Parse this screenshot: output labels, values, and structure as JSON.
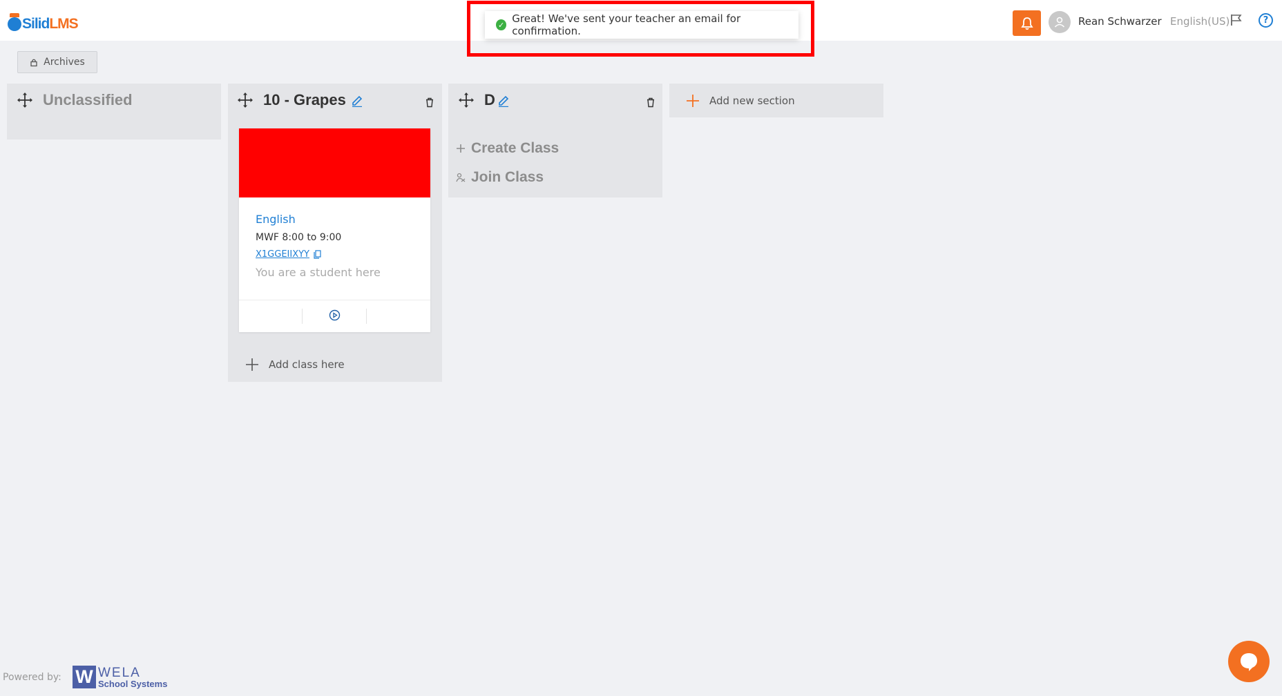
{
  "header": {
    "logo_text_1": "Silid",
    "logo_text_2": "LMS",
    "user_name": "Rean Schwarzer",
    "language": "English(US)"
  },
  "toast": {
    "message": "Great! We've sent your teacher an email for confirmation."
  },
  "toolbar": {
    "archives_label": "Archives"
  },
  "sections": [
    {
      "title": "Unclassified"
    },
    {
      "title": "10 - Grapes"
    },
    {
      "title": "D"
    }
  ],
  "class_card": {
    "subject": "English",
    "schedule": "MWF 8:00 to 9:00",
    "code": "X1GGEIIXYY",
    "role": "You are a student here",
    "banner_color": "#ff0000"
  },
  "actions": {
    "add_class": "Add class here",
    "create_class": "Create Class",
    "join_class": "Join Class",
    "add_section": "Add new section"
  },
  "footer": {
    "powered_by": "Powered by:",
    "brand_name": "WELA",
    "brand_sub": "School Systems"
  },
  "colors": {
    "accent": "#f37021",
    "link": "#1f7fd4",
    "highlight_frame": "#ff0000"
  },
  "icons": [
    "bell-icon",
    "user-icon",
    "flag-icon",
    "help-icon",
    "lock-icon",
    "move-icon",
    "edit-icon",
    "trash-icon",
    "copy-icon",
    "play-icon",
    "plus-icon",
    "join-icon",
    "chat-icon",
    "check-icon"
  ]
}
